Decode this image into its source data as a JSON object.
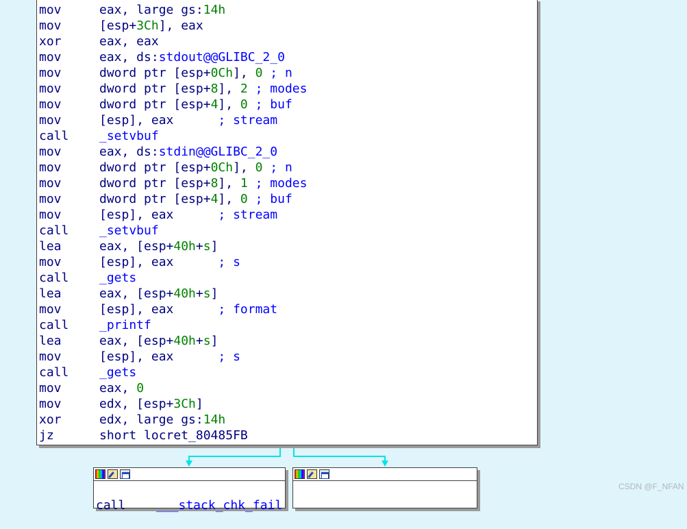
{
  "main_block": {
    "lines": [
      {
        "mn": "mov",
        "ops": [
          {
            "t": "eax, large ",
            "c": "reg"
          },
          {
            "t": "gs:",
            "c": "reg"
          },
          {
            "t": "14h",
            "c": "num"
          }
        ]
      },
      {
        "mn": "mov",
        "ops": [
          {
            "t": "[esp+",
            "c": "reg"
          },
          {
            "t": "3Ch",
            "c": "num"
          },
          {
            "t": "], eax",
            "c": "reg"
          }
        ]
      },
      {
        "mn": "xor",
        "ops": [
          {
            "t": "eax, eax",
            "c": "reg"
          }
        ]
      },
      {
        "mn": "mov",
        "ops": [
          {
            "t": "eax, ds:",
            "c": "reg"
          },
          {
            "t": "stdout@@GLIBC_2_0",
            "c": "sym"
          }
        ]
      },
      {
        "mn": "mov",
        "ops": [
          {
            "t": "dword ptr [esp+",
            "c": "reg"
          },
          {
            "t": "0Ch",
            "c": "num"
          },
          {
            "t": "], ",
            "c": "reg"
          },
          {
            "t": "0",
            "c": "num"
          },
          {
            "t": " ; n",
            "c": "cmt"
          }
        ]
      },
      {
        "mn": "mov",
        "ops": [
          {
            "t": "dword ptr [esp+",
            "c": "reg"
          },
          {
            "t": "8",
            "c": "num"
          },
          {
            "t": "], ",
            "c": "reg"
          },
          {
            "t": "2",
            "c": "num"
          },
          {
            "t": " ; modes",
            "c": "cmt"
          }
        ]
      },
      {
        "mn": "mov",
        "ops": [
          {
            "t": "dword ptr [esp+",
            "c": "reg"
          },
          {
            "t": "4",
            "c": "num"
          },
          {
            "t": "], ",
            "c": "reg"
          },
          {
            "t": "0",
            "c": "num"
          },
          {
            "t": " ; buf",
            "c": "cmt"
          }
        ]
      },
      {
        "mn": "mov",
        "ops": [
          {
            "t": "[esp], eax      ",
            "c": "reg"
          },
          {
            "t": "; stream",
            "c": "cmt"
          }
        ]
      },
      {
        "mn": "call",
        "ops": [
          {
            "t": "_setvbuf",
            "c": "sym"
          }
        ]
      },
      {
        "mn": "mov",
        "ops": [
          {
            "t": "eax, ds:",
            "c": "reg"
          },
          {
            "t": "stdin@@GLIBC_2_0",
            "c": "sym"
          }
        ]
      },
      {
        "mn": "mov",
        "ops": [
          {
            "t": "dword ptr [esp+",
            "c": "reg"
          },
          {
            "t": "0Ch",
            "c": "num"
          },
          {
            "t": "], ",
            "c": "reg"
          },
          {
            "t": "0",
            "c": "num"
          },
          {
            "t": " ; n",
            "c": "cmt"
          }
        ]
      },
      {
        "mn": "mov",
        "ops": [
          {
            "t": "dword ptr [esp+",
            "c": "reg"
          },
          {
            "t": "8",
            "c": "num"
          },
          {
            "t": "], ",
            "c": "reg"
          },
          {
            "t": "1",
            "c": "num"
          },
          {
            "t": " ; modes",
            "c": "cmt"
          }
        ]
      },
      {
        "mn": "mov",
        "ops": [
          {
            "t": "dword ptr [esp+",
            "c": "reg"
          },
          {
            "t": "4",
            "c": "num"
          },
          {
            "t": "], ",
            "c": "reg"
          },
          {
            "t": "0",
            "c": "num"
          },
          {
            "t": " ; buf",
            "c": "cmt"
          }
        ]
      },
      {
        "mn": "mov",
        "ops": [
          {
            "t": "[esp], eax      ",
            "c": "reg"
          },
          {
            "t": "; stream",
            "c": "cmt"
          }
        ]
      },
      {
        "mn": "call",
        "ops": [
          {
            "t": "_setvbuf",
            "c": "sym"
          }
        ]
      },
      {
        "mn": "lea",
        "ops": [
          {
            "t": "eax, [esp+",
            "c": "reg"
          },
          {
            "t": "40h",
            "c": "num"
          },
          {
            "t": "+",
            "c": "reg"
          },
          {
            "t": "s",
            "c": "num"
          },
          {
            "t": "]",
            "c": "reg"
          }
        ]
      },
      {
        "mn": "mov",
        "ops": [
          {
            "t": "[esp], eax      ",
            "c": "reg"
          },
          {
            "t": "; s",
            "c": "cmt"
          }
        ]
      },
      {
        "mn": "call",
        "ops": [
          {
            "t": "_gets",
            "c": "sym"
          }
        ]
      },
      {
        "mn": "lea",
        "ops": [
          {
            "t": "eax, [esp+",
            "c": "reg"
          },
          {
            "t": "40h",
            "c": "num"
          },
          {
            "t": "+",
            "c": "reg"
          },
          {
            "t": "s",
            "c": "num"
          },
          {
            "t": "]",
            "c": "reg"
          }
        ]
      },
      {
        "mn": "mov",
        "ops": [
          {
            "t": "[esp], eax      ",
            "c": "reg"
          },
          {
            "t": "; format",
            "c": "cmt"
          }
        ]
      },
      {
        "mn": "call",
        "ops": [
          {
            "t": "_printf",
            "c": "sym"
          }
        ]
      },
      {
        "mn": "lea",
        "ops": [
          {
            "t": "eax, [esp+",
            "c": "reg"
          },
          {
            "t": "40h",
            "c": "num"
          },
          {
            "t": "+",
            "c": "reg"
          },
          {
            "t": "s",
            "c": "num"
          },
          {
            "t": "]",
            "c": "reg"
          }
        ]
      },
      {
        "mn": "mov",
        "ops": [
          {
            "t": "[esp], eax      ",
            "c": "reg"
          },
          {
            "t": "; s",
            "c": "cmt"
          }
        ]
      },
      {
        "mn": "call",
        "ops": [
          {
            "t": "_gets",
            "c": "sym"
          }
        ]
      },
      {
        "mn": "mov",
        "ops": [
          {
            "t": "eax, ",
            "c": "reg"
          },
          {
            "t": "0",
            "c": "num"
          }
        ]
      },
      {
        "mn": "mov",
        "ops": [
          {
            "t": "edx, [esp+",
            "c": "reg"
          },
          {
            "t": "3Ch",
            "c": "num"
          },
          {
            "t": "]",
            "c": "reg"
          }
        ]
      },
      {
        "mn": "xor",
        "ops": [
          {
            "t": "edx, large ",
            "c": "reg"
          },
          {
            "t": "gs:",
            "c": "reg"
          },
          {
            "t": "14h",
            "c": "num"
          }
        ]
      },
      {
        "mn": "jz",
        "ops": [
          {
            "t": "short locret_80485FB",
            "c": "reg"
          }
        ]
      }
    ]
  },
  "left_block": {
    "mnemonic": "call",
    "operand": "___stack_chk_fail"
  },
  "right_block": {},
  "icons": [
    "color-palette-icon",
    "edit-pencil-icon",
    "graph-view-icon"
  ],
  "colors": {
    "background": "#e0f4fb",
    "edge": "#00e5e5",
    "register": "#000080",
    "number": "#008000",
    "comment": "#0000ff"
  },
  "watermark": "CSDN @F_NFAN"
}
